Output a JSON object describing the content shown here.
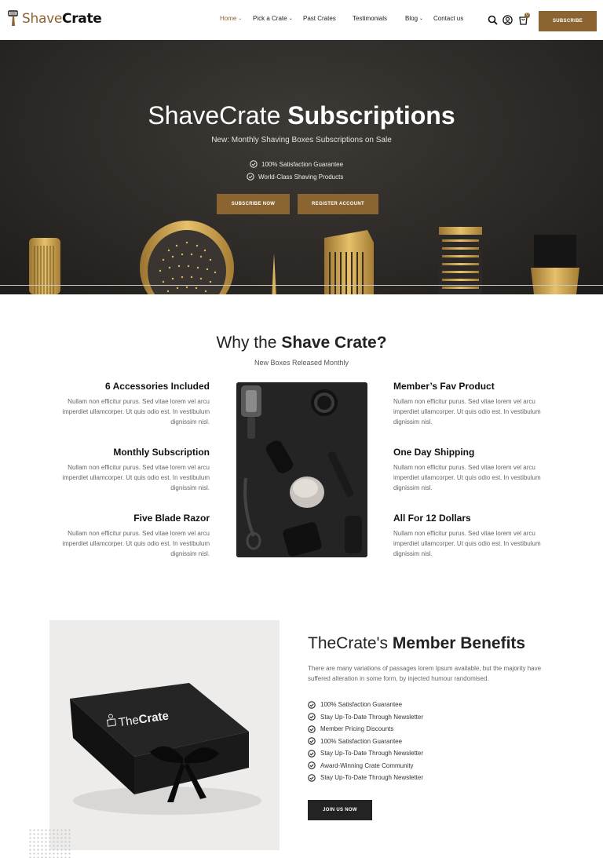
{
  "header": {
    "logo_shave": "Shave",
    "logo_crate": "Crate",
    "nav": [
      {
        "label": "Home",
        "has_dropdown": true,
        "active": true
      },
      {
        "label": "Pick a Crate",
        "has_dropdown": true
      },
      {
        "label": "Past Crates"
      },
      {
        "label": "Testimonials"
      },
      {
        "label": "Blog",
        "has_dropdown": true
      },
      {
        "label": "Contact us"
      }
    ],
    "icons": [
      "search-icon",
      "user-icon",
      "cart-icon"
    ],
    "cart_count": "0",
    "subscribe_label": "SUBSCRIBE"
  },
  "hero": {
    "title_light": "ShaveCrate",
    "title_bold": "Subscriptions",
    "subtitle": "New: Monthly Shaving Boxes Subscriptions on Sale",
    "checks": [
      "100% Satisfaction Guarantee",
      "World-Class Shaving Products"
    ],
    "btn_subscribe": "SUBSCRIBE NOW",
    "btn_register": "REGISTER ACCOUNT"
  },
  "why": {
    "title_light": "Why the",
    "title_bold": "Shave Crate?",
    "subtitle": "New Boxes Released Monthly",
    "features_left": [
      {
        "title": "6 Accessories Included",
        "desc": "Nullam non efficitur purus. Sed vitae lorem vel arcu imperdiet ullamcorper. Ut quis odio est. In vestibulum dignissim nisl."
      },
      {
        "title": "Monthly Subscription",
        "desc": "Nullam non efficitur purus. Sed vitae lorem vel arcu imperdiet ullamcorper. Ut quis odio est. In vestibulum dignissim nisl."
      },
      {
        "title": "Five Blade Razor",
        "desc": "Nullam non efficitur purus. Sed vitae lorem vel arcu imperdiet ullamcorper. Ut quis odio est. In vestibulum dignissim nisl."
      }
    ],
    "features_right": [
      {
        "title": "Member’s Fav Product",
        "desc": "Nullam non efficitur purus. Sed vitae lorem vel arcu imperdiet ullamcorper. Ut quis odio est. In vestibulum dignissim nisl."
      },
      {
        "title": "One Day Shipping",
        "desc": "Nullam non efficitur purus. Sed vitae lorem vel arcu imperdiet ullamcorper. Ut quis odio est. In vestibulum dignissim nisl."
      },
      {
        "title": "All For 12 Dollars",
        "desc": "Nullam non efficitur purus. Sed vitae lorem vel arcu imperdiet ullamcorper. Ut quis odio est. In vestibulum dignissim nisl."
      }
    ]
  },
  "benefits": {
    "box_logo_the": "The",
    "box_logo_crate": "Crate",
    "title_light": "TheCrate's",
    "title_bold": "Member Benefits",
    "desc": "There are many variations of passages lorem Ipsum available, but the majority have suffered alteration in some form, by injected humour randomised.",
    "items": [
      "100% Satisfaction Guarantee",
      "Stay Up-To-Date Through Newsletter",
      "Member Pricing Discounts",
      "100% Satisfaction Guarantee",
      "Stay Up-To-Date Through Newsletter",
      "Award-Winning Crate Community",
      "Stay Up-To-Date Through Newsletter"
    ],
    "join_label": "JOIN US NOW"
  },
  "colors": {
    "accent": "#8b6431",
    "dark": "#232323",
    "hero_bg": "#2d2a27"
  }
}
